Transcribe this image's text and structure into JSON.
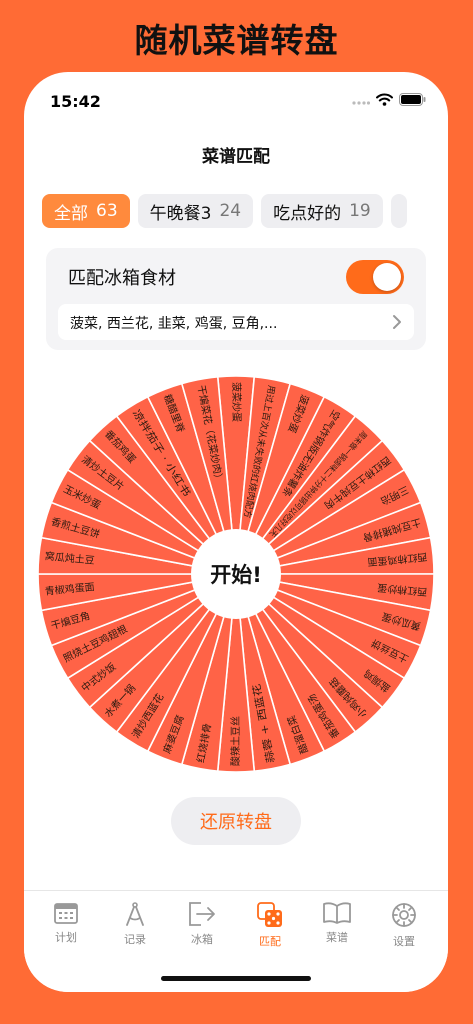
{
  "headline": "随机菜谱转盘",
  "status": {
    "time": "15:42"
  },
  "nav": {
    "title": "菜谱匹配"
  },
  "chips": [
    {
      "label": "全部",
      "count": "63",
      "active": true
    },
    {
      "label": "午晚餐3",
      "count": "24",
      "active": false
    },
    {
      "label": "吃点好的",
      "count": "19",
      "active": false
    }
  ],
  "fridge": {
    "label": "匹配冰箱食材",
    "toggle_on": true,
    "ingredients": "菠菜, 西兰花, 韭菜, 鸡蛋, 豆角,..."
  },
  "wheel": {
    "center_label": "开始!",
    "segments": [
      "菠菜炒蛋",
      "用过上百次从未失败的红烧肉配方",
      "菠菜炒蛋",
      "空气炸锅版无油炸薯条",
      "周末做一锅卤味二十分钟出锅可以吃好几天",
      "西红柿土豆炖牛肉",
      "三明治",
      "土豆炖猪排骨",
      "西红柿鸡蛋面",
      "西红柿炒蛋",
      "黄瓜炒蛋",
      "土豆丝饼",
      "盐焗鸡",
      "小鸡炖蘑菇",
      "番茄鸡蛋汤",
      "醋溜白菜",
      "蒜蓉 + 西蓝花",
      "酸辣土豆丝",
      "红烧排骨",
      "麻婆豆腐",
      "清炒西蓝花",
      "水煮一锅",
      "中式炒饭",
      "照烧土豆鸡翅根",
      "干煸豆角",
      "青椒鸡蛋面",
      "窝瓜炖土豆",
      "香煎土豆饼",
      "玉米炒蛋",
      "清炒土豆片",
      "番茄鸡蛋",
      "凉拌茄子 · 小红书",
      "糖醋里脊",
      "干煸菜花（花菜炒肉）"
    ]
  },
  "restore_button": "还原转盘",
  "tabs": [
    {
      "label": "计划",
      "icon": "calendar-icon",
      "active": false
    },
    {
      "label": "记录",
      "icon": "compass-icon",
      "active": false
    },
    {
      "label": "冰箱",
      "icon": "fridge-exit-icon",
      "active": false
    },
    {
      "label": "匹配",
      "icon": "dice-icon",
      "active": true
    },
    {
      "label": "菜谱",
      "icon": "book-icon",
      "active": false
    },
    {
      "label": "设置",
      "icon": "gear-icon",
      "active": false
    }
  ],
  "colors": {
    "brand": "#FF6B35",
    "segment": "#FF6347",
    "accent": "#FF6B1A",
    "chip_active": "#FF8A3D"
  }
}
